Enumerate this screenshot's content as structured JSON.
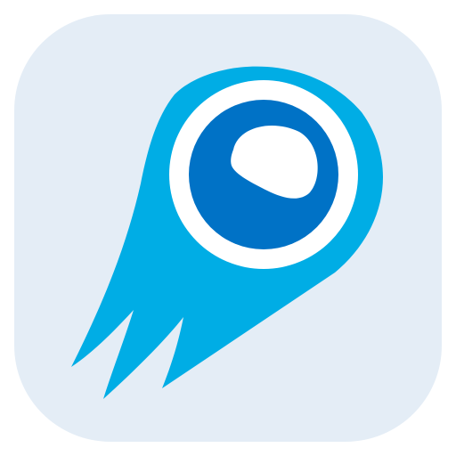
{
  "app_icon": {
    "name": "comet-logo-icon",
    "colors": {
      "tile_background": "#e4edf6",
      "comet_body": "#00ade5",
      "ring": "#ffffff",
      "core": "#0072c6",
      "highlight": "#ffffff"
    }
  }
}
